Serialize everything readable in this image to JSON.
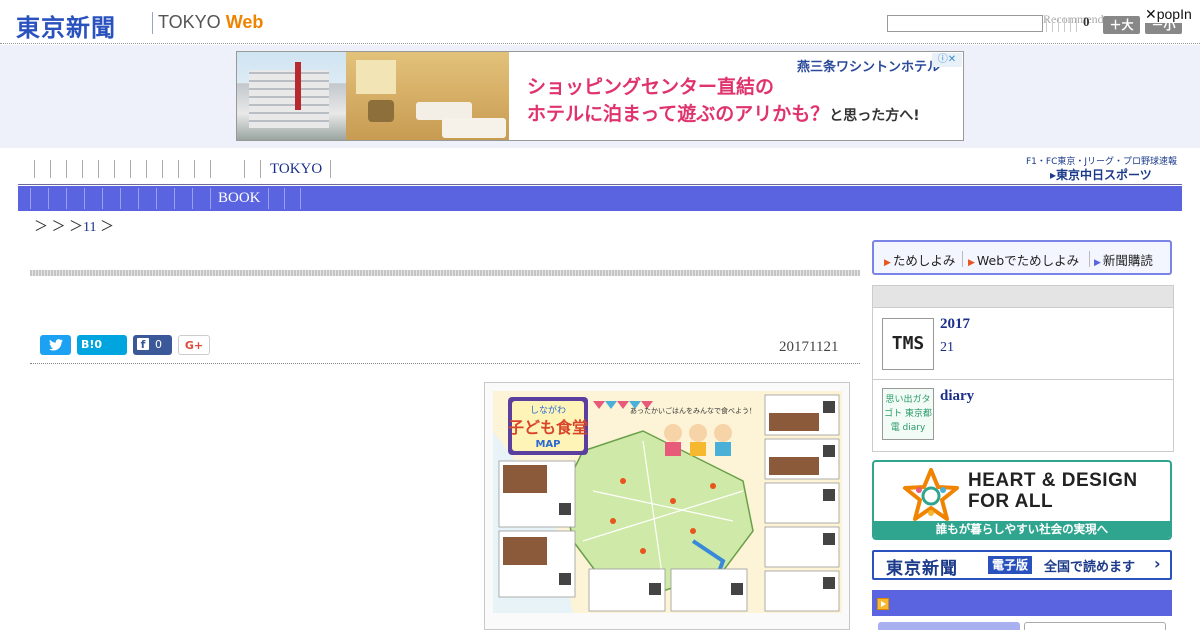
{
  "header": {
    "logo_jp": "東京新聞",
    "logo_en": "TOKYO",
    "logo_web": "Web",
    "search_placeholder": "",
    "recommend_label": "Recommend",
    "font_count": "0",
    "font_large_label": "＋大",
    "font_small_label": "－小",
    "popin_label": "✕popIn"
  },
  "ad": {
    "hotel_name": "燕三条ワシントンホテル",
    "copy_line1": "ショッピングセンター直結の",
    "copy_line2": "ホテルに泊まって遊ぶのアリかも？",
    "copy_tail": "と思った方へ!",
    "choices_label": "ⓘ✕"
  },
  "nav1": {
    "tokyo_label": "TOKYO",
    "sports_tagline": "F1・FC東京・Jリーグ・プロ野球速報",
    "sports_logo": "▸東京中日スポーツ"
  },
  "nav2": {
    "book_label": "BOOK"
  },
  "breadcrumb": {
    "sep1": "＞",
    "sep2": "＞",
    "sep3": "＞",
    "link": "11",
    "sep4": "＞"
  },
  "article": {
    "date": "20171121",
    "share": {
      "twitter": "🐦",
      "hatena": "B!0",
      "facebook_icon": "f",
      "facebook_count": "0",
      "gplus": "G+"
    },
    "map": {
      "title_top": "しながわ",
      "title_main": "子ども食堂",
      "title_sub": "MAP",
      "banner": "あったかいごはんをみんなで食べよう！"
    }
  },
  "sidebar": {
    "tabs": [
      "ためしよみ",
      "Webでためしよみ",
      "新聞購読"
    ],
    "ranking": [
      {
        "thumb": "TMS",
        "title": "2017",
        "sub": "21"
      },
      {
        "thumb": "思い出ガタゴト 東京都電 diary",
        "title": "diary",
        "sub": ""
      }
    ],
    "heart": {
      "title_line1": "HEART & DESIGN",
      "title_line2": "FOR ALL",
      "strip": "誰もが暮らしやすい社会の実現へ"
    },
    "epaper": {
      "logo": "東京新聞",
      "badge": "電子版",
      "text": "全国で読めます",
      "arrow": "›"
    }
  },
  "colors": {
    "brand_blue": "#2a52be",
    "nav_blue": "#5a64e0",
    "ad_pink": "#e0336e",
    "heart_green": "#2fa58f"
  }
}
